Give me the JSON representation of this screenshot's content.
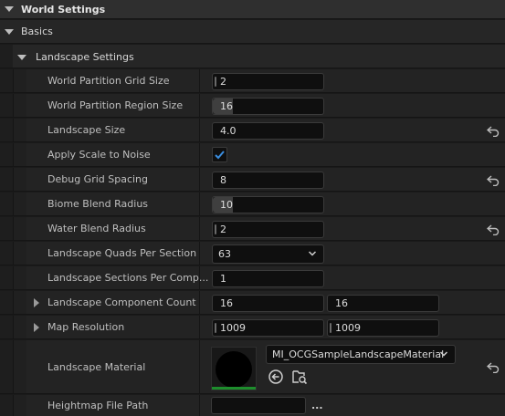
{
  "categories": {
    "world_settings": "World Settings",
    "basics": "Basics",
    "landscape_settings": "Landscape Settings"
  },
  "rows": {
    "grid_size": {
      "label": "World Partition Grid Size",
      "value": "2"
    },
    "region_size": {
      "label": "World Partition Region Size",
      "value": "16"
    },
    "landscape_size": {
      "label": "Landscape Size",
      "value": "4.0"
    },
    "apply_scale": {
      "label": "Apply Scale to Noise",
      "checked": true
    },
    "debug_grid": {
      "label": "Debug Grid Spacing",
      "value": "8"
    },
    "biome_blend": {
      "label": "Biome Blend Radius",
      "value": "10"
    },
    "water_blend": {
      "label": "Water Blend Radius",
      "value": "2"
    },
    "quads": {
      "label": "Landscape Quads Per Section",
      "value": "63"
    },
    "sections": {
      "label": "Landscape Sections Per Comp...",
      "value": "1"
    },
    "component_count": {
      "label": "Landscape Component Count",
      "x": "16",
      "y": "16"
    },
    "map_resolution": {
      "label": "Map Resolution",
      "x": "1009",
      "y": "1009"
    },
    "material": {
      "label": "Landscape Material",
      "value": "MI_OCGSampleLandscapeMaterial"
    },
    "heightmap": {
      "label": "Heightmap File Path",
      "value": "",
      "browse": "..."
    }
  },
  "colors": {
    "accent": "#1d8d2c",
    "check": "#3a8dde"
  },
  "icons": [
    "chevron-down-icon",
    "chevron-right-icon",
    "reset-arrow-icon",
    "checkmark-icon",
    "use-selected-asset-icon",
    "browse-asset-icon"
  ]
}
